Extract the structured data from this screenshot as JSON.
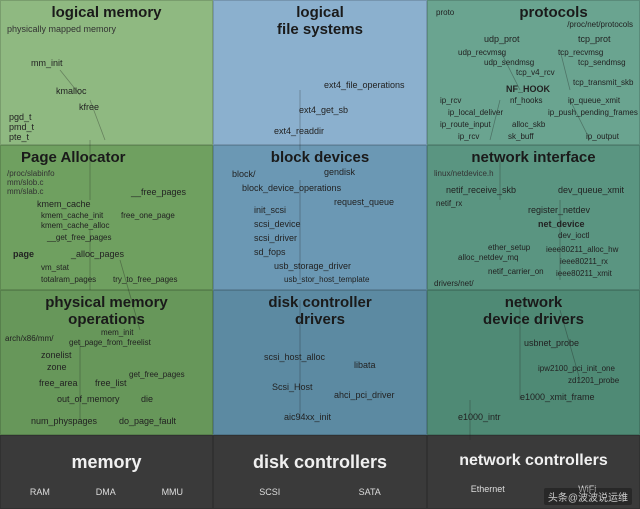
{
  "grid": {
    "r1c1": {
      "title": "logical memory",
      "subtitle": "physically mapped memory"
    },
    "r1c2": {
      "title": "logical\nfile systems"
    },
    "r1c3": {
      "title": "protocols",
      "side": "/proc/net/protocols",
      "tiny": "proto"
    },
    "r2c1": {
      "title": "Page Allocator",
      "side": "/proc/slabinfo\nmm/slob.c\nmm/slab.c"
    },
    "r2c2": {
      "title": "block devices"
    },
    "r2c3": {
      "title": "network interface",
      "side": "linux/netdevice.h"
    },
    "r3c1": {
      "title": "physical memory\noperations",
      "side": "arch/x86/mm/"
    },
    "r3c2": {
      "title": "disk controller\ndrivers"
    },
    "r3c3": {
      "title": "network\ndevice drivers"
    },
    "r4c1": {
      "title": "memory",
      "labels": [
        "RAM",
        "DMA",
        "MMU"
      ]
    },
    "r4c2": {
      "title": "disk controllers",
      "labels": [
        "SCSI",
        "SATA"
      ]
    },
    "r4c3": {
      "title": "network controllers",
      "labels": [
        "Ethernet",
        "WiFi"
      ]
    }
  },
  "nodes": {
    "mm_init": "mm_init",
    "kmalloc": "kmalloc",
    "kfree": "kfree",
    "pgd_t": "pgd_t",
    "pmd_t": "pmd_t",
    "pte_t": "pte_t",
    "ext4_file_ops": "ext4_file_operations",
    "ext4_get_sb": "ext4_get_sb",
    "ext4_readdir": "ext4_readdir",
    "udp_prot": "udp_prot",
    "tcp_prot": "tcp_prot",
    "udp_recvmsg": "udp_recvmsg",
    "tcp_recvmsg": "tcp_recvmsg",
    "udp_sendmsg": "udp_sendmsg",
    "tcp_sendmsg": "tcp_sendmsg",
    "tcp_v4_rcv": "tcp_v4_rcv",
    "tcp_transmit_skb": "tcp_transmit_skb",
    "nf_hook": "NF_HOOK",
    "nf_hooks": "nf_hooks",
    "ip_rcv": "ip_rcv",
    "ip_queue_xmit": "ip_queue_xmit",
    "ip_local_deliver": "ip_local_deliver",
    "ip_push_pending": "ip_push_pending_frames",
    "ip_route_input": "ip_route_input",
    "alloc_skb": "alloc_skb",
    "ip_rcv2": "ip_rcv",
    "sk_buff": "sk_buff",
    "ip_output": "ip_output",
    "kmem_cache": "kmem_cache",
    "kmem_cache_init": "kmem_cache_init",
    "kmem_cache_alloc": "kmem_cache_alloc",
    "get_free_pages": "__get_free_pages",
    "free_pages": "__free_pages",
    "free_one_page": "free_one_page",
    "page": "page",
    "alloc_pages": "_alloc_pages",
    "vm_stat": "vm_stat",
    "totalram": "totalram_pages",
    "try_to_free": "try_to_free_pages",
    "block": "block/",
    "gendisk": "gendisk",
    "block_dev_ops": "block_device_operations",
    "request_queue": "request_queue",
    "init_scsi": "init_scsi",
    "scsi_device": "scsi_device",
    "scsi_driver": "scsi_driver",
    "sd_fops": "sd_fops",
    "usb_storage": "usb_storage_driver",
    "usb_stor_host": "usb_stor_host_template",
    "netif_receive": "netif_receive_skb",
    "dev_queue_xmit": "dev_queue_xmit",
    "netif_rx": "netif_rx",
    "register_netdev": "register_netdev",
    "net_device": "net_device",
    "dev_ioctl": "dev_ioctl",
    "ether_setup": "ether_setup",
    "alloc_netdev_mq": "alloc_netdev_mq",
    "ieee_alloc": "ieee80211_alloc_hw",
    "ieee_rx": "ieee80211_rx",
    "ieee_xmit": "ieee80211_xmit",
    "netif_carrier": "netif_carrier_on",
    "drivers_net": "drivers/net/",
    "mem_init": "mem_init",
    "get_page_freelist": "get_page_from_freelist",
    "zonelist": "zonelist",
    "zone": "zone",
    "free_area": "free_area",
    "free_list": "free_list",
    "out_of_memory": "out_of_memory",
    "die": "die",
    "num_physpages": "num_physpages",
    "do_page_fault": "do_page_fault",
    "get_free_pages2": "get_free_pages",
    "scsi_host_alloc": "scsi_host_alloc",
    "libata": "libata",
    "scsi_host": "Scsi_Host",
    "ahci_pci": "ahci_pci_driver",
    "aic94xx": "aic94xx_init",
    "usbnet_probe": "usbnet_probe",
    "ipw2100": "ipw2100_pci_init_one",
    "zd1201": "zd1201_probe",
    "e1000_xmit": "e1000_xmit_frame",
    "e1000_intr": "e1000_intr"
  },
  "watermark": "头条@波波说运维"
}
